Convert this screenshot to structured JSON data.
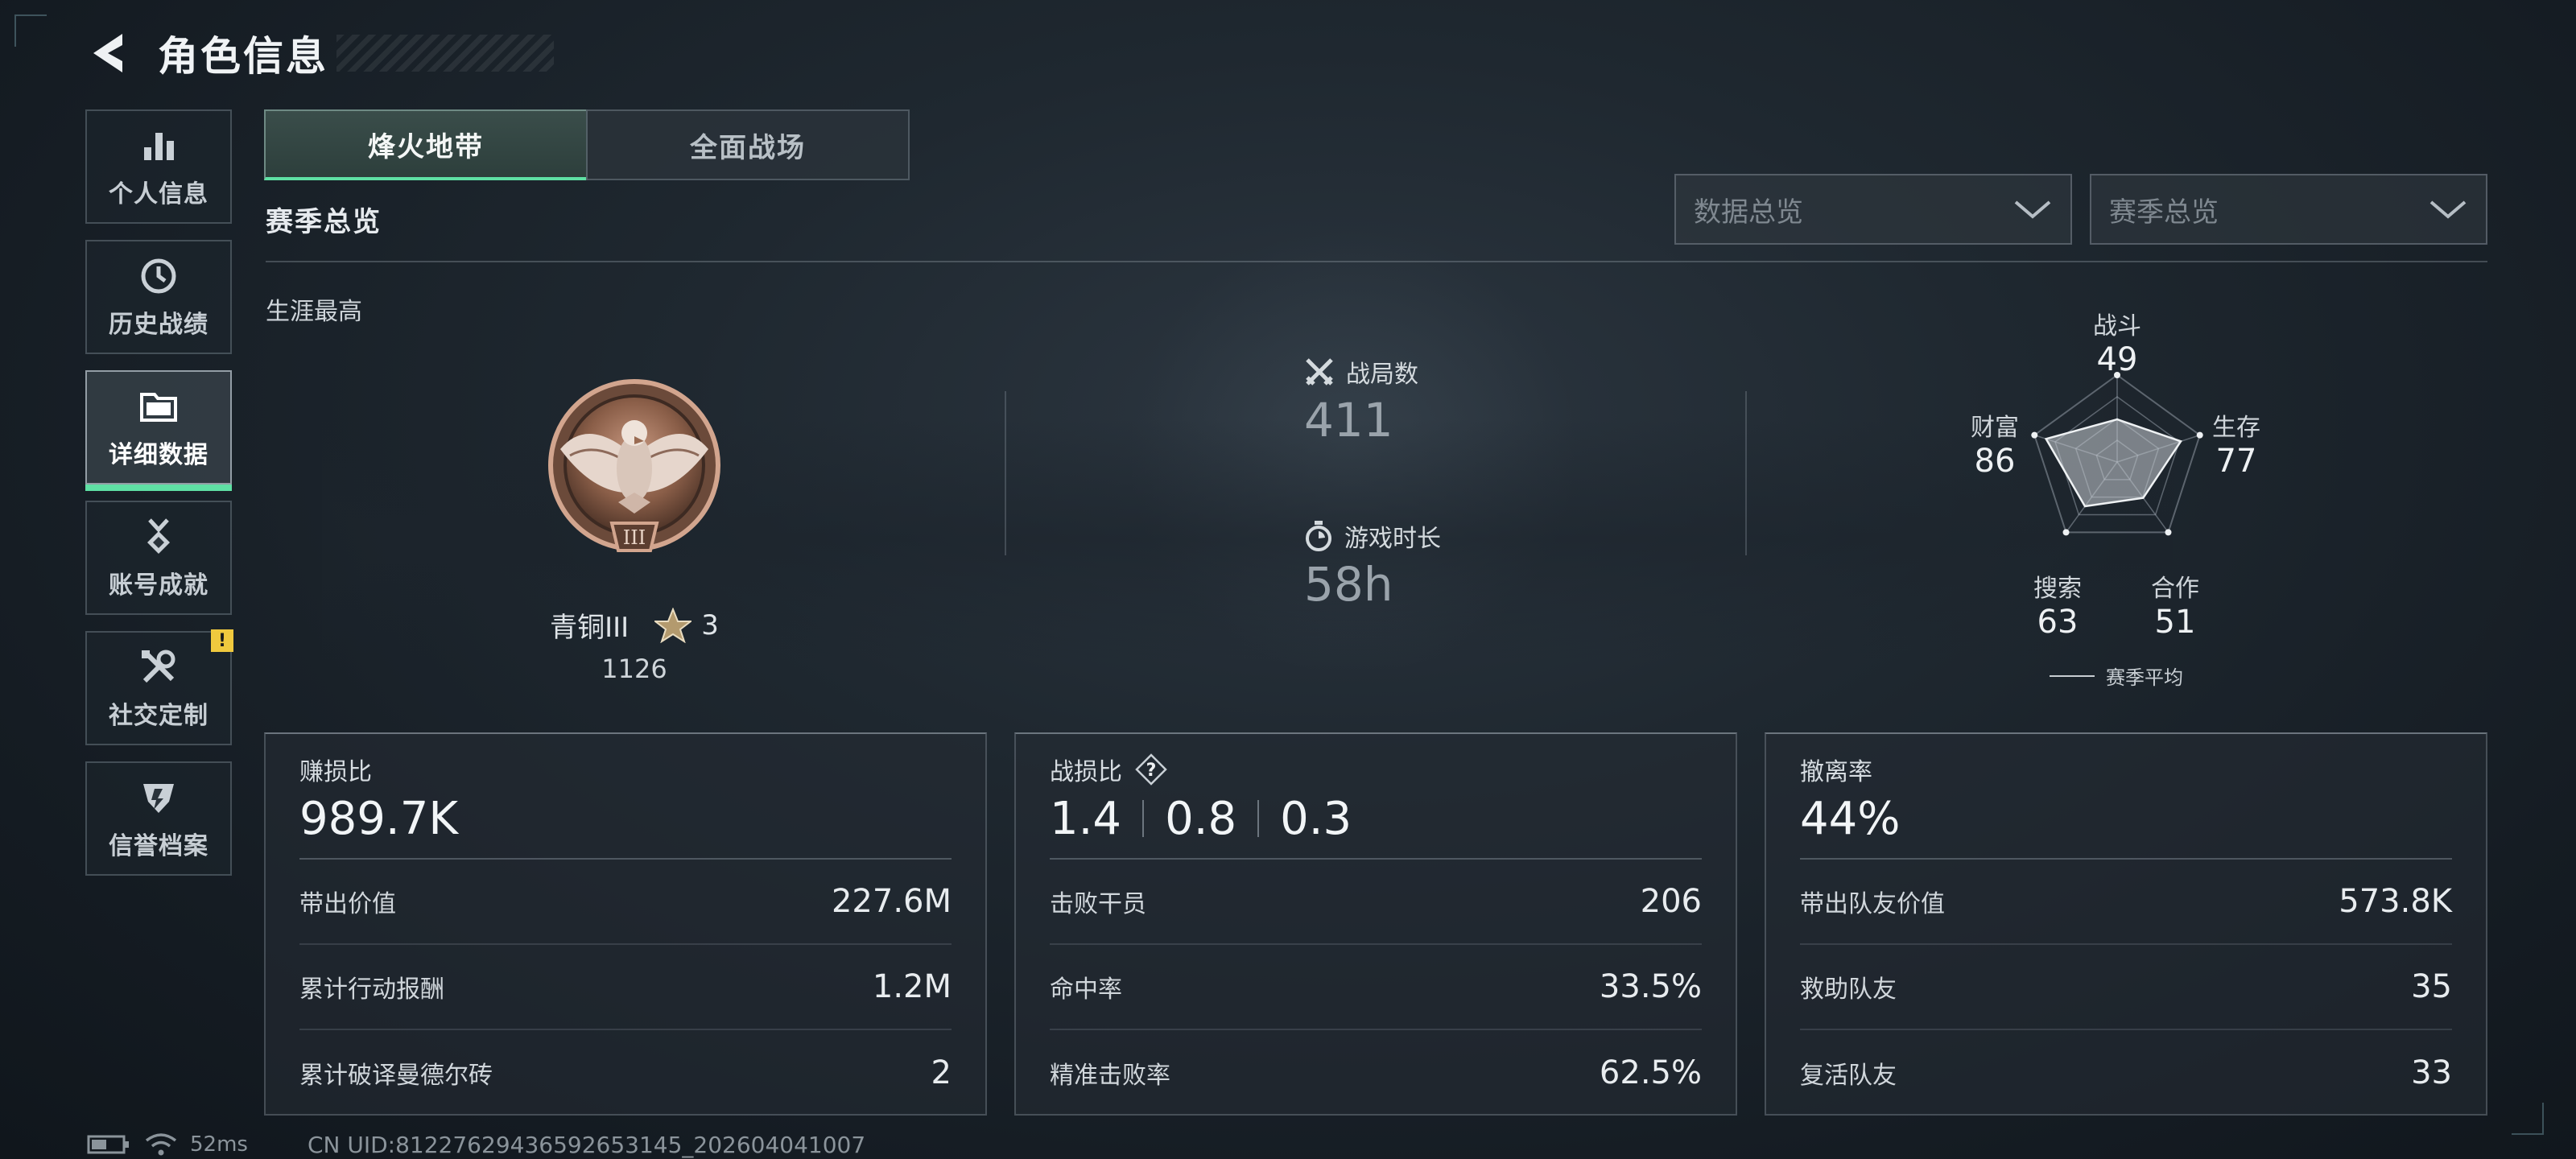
{
  "header": {
    "title": "角色信息"
  },
  "sidebar": {
    "items": [
      {
        "label": "个人信息",
        "icon": "bar-chart-icon"
      },
      {
        "label": "历史战绩",
        "icon": "clock-icon"
      },
      {
        "label": "详细数据",
        "icon": "folder-icon",
        "active": true
      },
      {
        "label": "账号成就",
        "icon": "medal-icon"
      },
      {
        "label": "社交定制",
        "icon": "tools-icon",
        "badge": "!"
      },
      {
        "label": "信誉档案",
        "icon": "shield-icon"
      }
    ]
  },
  "tabs": [
    {
      "label": "烽火地带",
      "active": true
    },
    {
      "label": "全面战场",
      "active": false
    }
  ],
  "section": {
    "title": "赛季总览",
    "career_label": "生涯最高"
  },
  "filters": {
    "data_select": "数据总览",
    "season_select": "赛季总览"
  },
  "rank": {
    "name": "青铜III",
    "emblem_numeral": "III",
    "stars": "3",
    "score": "1126"
  },
  "stats": {
    "matches": {
      "label": "战局数",
      "value": "411",
      "icon": "crossed-swords-icon"
    },
    "playtime": {
      "label": "游戏时长",
      "value": "58h",
      "icon": "stopwatch-icon"
    }
  },
  "radar": {
    "axes": [
      {
        "label": "战斗",
        "value": 49
      },
      {
        "label": "生存",
        "value": 77
      },
      {
        "label": "合作",
        "value": 51
      },
      {
        "label": "搜索",
        "value": 63
      },
      {
        "label": "财富",
        "value": 86
      }
    ],
    "legend": "赛季平均"
  },
  "cards": [
    {
      "title": "赚损比",
      "main": "989.7K",
      "rows": [
        {
          "label": "带出价值",
          "value": "227.6M"
        },
        {
          "label": "累计行动报酬",
          "value": "1.2M"
        },
        {
          "label": "累计破译曼德尔砖",
          "value": "2"
        }
      ]
    },
    {
      "title": "战损比",
      "ratios": [
        "1.4",
        "0.8",
        "0.3"
      ],
      "help": "?",
      "rows": [
        {
          "label": "击败干员",
          "value": "206"
        },
        {
          "label": "命中率",
          "value": "33.5%"
        },
        {
          "label": "精准击败率",
          "value": "62.5%"
        }
      ]
    },
    {
      "title": "撤离率",
      "main": "44%",
      "rows": [
        {
          "label": "带出队友价值",
          "value": "573.8K"
        },
        {
          "label": "救助队友",
          "value": "35"
        },
        {
          "label": "复活队友",
          "value": "33"
        }
      ]
    }
  ],
  "footer": {
    "ping": "52ms",
    "uid": "CN UID:8122762943659265314​5_202604041007"
  },
  "colors": {
    "accent": "#5fe0a4",
    "badge": "#f0c93e",
    "bronze": "#9a6b52"
  }
}
